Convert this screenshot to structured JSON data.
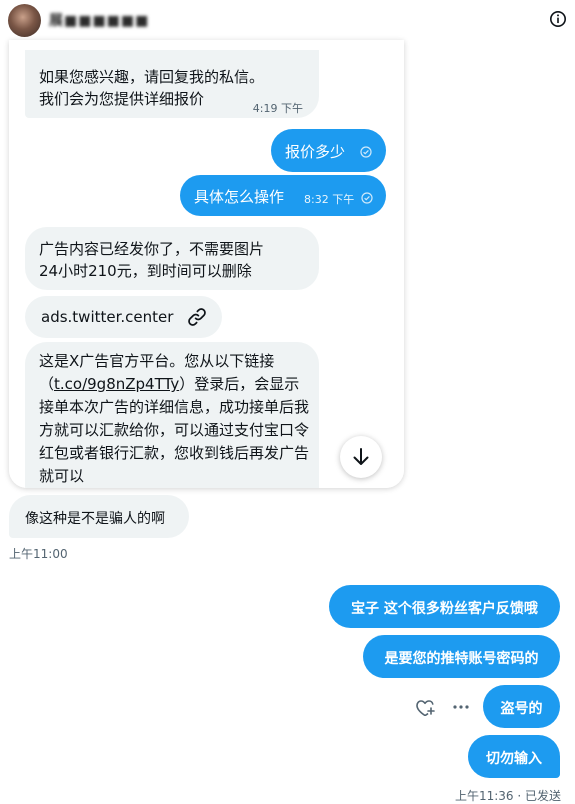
{
  "header": {
    "title": "展■■■■■■"
  },
  "shared_conversation": {
    "messages": [
      {
        "text_line1": "如果您感兴趣，请回复我的私信。",
        "text_line2": "我们会为您提供详细报价",
        "time": "4:19 下午"
      },
      {
        "text": "报价多少"
      },
      {
        "text": "具体怎么操作",
        "time": "8:32 下午"
      },
      {
        "text_line1": "广告内容已经发你了，不需要图片",
        "text_line2": "24小时210元，到时间可以删除"
      },
      {
        "text": "ads.twitter.center"
      },
      {
        "text_part1": "这是X广告官方平台。您从以下链接（",
        "link": "t.co/9g8nZp4TTy",
        "text_part2": "）登录后，会显示接单本次广告的详细信息，成功接单后我方就可以汇款给你，可以通过支付宝口令红包或者银行汇款，您收到钱后再发广告就可以"
      }
    ]
  },
  "reply": {
    "text": "像这种是不是骗人的啊",
    "time": "上午11:00"
  },
  "outgoing": [
    {
      "text": "宝子 这个很多粉丝客户反馈哦"
    },
    {
      "text": "是要您的推特账号密码的"
    },
    {
      "text": "盗号的"
    },
    {
      "text": "切勿输入"
    }
  ],
  "status": "上午11:36 · 已发送",
  "colors": {
    "accent": "#1d9bf0",
    "bubble_gray": "#eff3f4",
    "muted": "#536471"
  }
}
